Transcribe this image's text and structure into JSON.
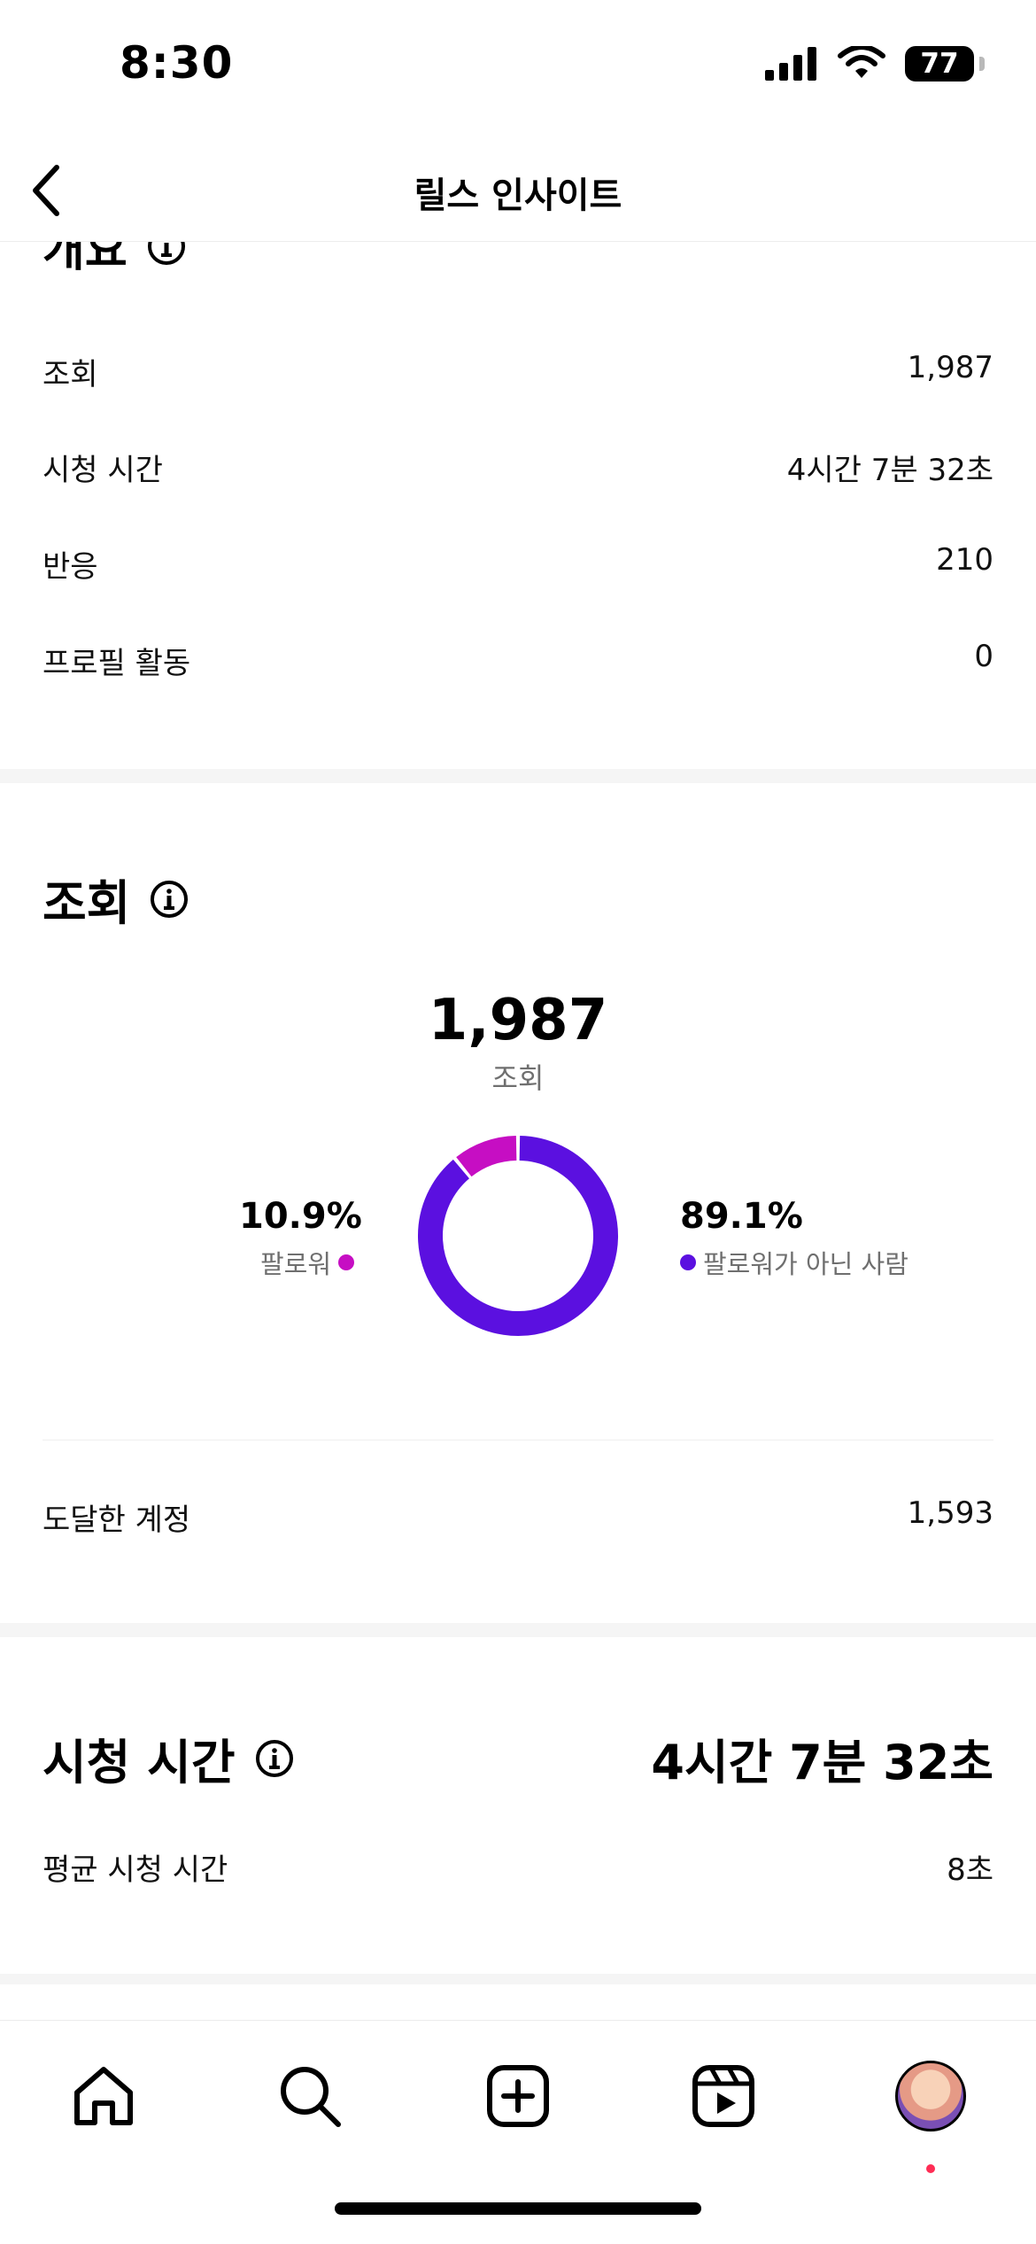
{
  "status_bar": {
    "time": "8:30",
    "battery": "77"
  },
  "header": {
    "title": "릴스 인사이트"
  },
  "overview": {
    "title": "개요",
    "rows": [
      {
        "label": "조회",
        "value": "1,987"
      },
      {
        "label": "시청 시간",
        "value": "4시간 7분 32초"
      },
      {
        "label": "반응",
        "value": "210"
      },
      {
        "label": "프로필 활동",
        "value": "0"
      }
    ]
  },
  "views": {
    "title": "조회",
    "total": "1,987",
    "total_caption": "조회",
    "followers": {
      "percent": "10.9%",
      "label": "팔로워"
    },
    "non_followers": {
      "percent": "89.1%",
      "label": "팔로워가 아닌 사람"
    },
    "reached": {
      "label": "도달한 계정",
      "value": "1,593"
    }
  },
  "chart_data": {
    "type": "pie",
    "categories": [
      "팔로워",
      "팔로워가 아닌 사람"
    ],
    "values": [
      10.9,
      89.1
    ],
    "colors": [
      "#c60ec3",
      "#5b10e0"
    ]
  },
  "watch_time": {
    "title": "시청 시간",
    "value": "4시간 7분 32초",
    "avg": {
      "label": "평균 시청 시간",
      "value": "8초"
    }
  },
  "icons": {
    "back": "chevron-left-icon",
    "info": "info-icon",
    "nav": [
      "home-icon",
      "search-icon",
      "create-icon",
      "reels-icon",
      "profile-avatar"
    ]
  }
}
